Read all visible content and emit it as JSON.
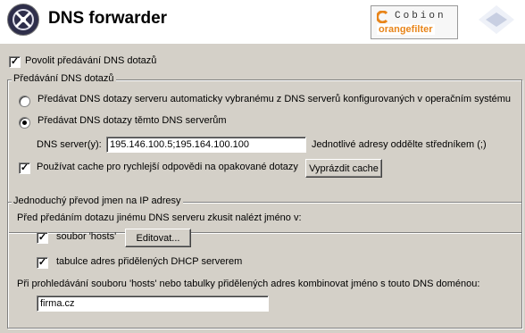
{
  "header": {
    "title": "DNS forwarder",
    "brand_top": "Cobion",
    "brand_bottom": "orangefilter"
  },
  "enable_forwarding": {
    "label": "Povolit předávání DNS dotazů",
    "checked": true
  },
  "forwarding_group": {
    "legend": "Předávání DNS dotazů",
    "radio_auto": {
      "label": "Předávat DNS dotazy serveru automaticky vybranému z DNS serverů konfigurovaných v operačním systému",
      "selected": false
    },
    "radio_manual": {
      "label": "Předávat DNS dotazy těmto DNS serverům",
      "selected": true
    },
    "dns_servers_label": "DNS server(y):",
    "dns_servers_value": "195.146.100.5;195.164.100.100",
    "dns_servers_hint": "Jednotlivé adresy oddělte středníkem (;)",
    "use_cache": {
      "label": "Používat cache pro rychlejší odpovědi na opakované dotazy",
      "checked": true
    },
    "clear_cache_button": "Vyprázdit cache"
  },
  "name_resolution_group": {
    "legend": "Jednoduchý převod jmen na IP adresy",
    "intro": "Před předáním dotazu jinému DNS serveru zkusit nalézt jméno v:",
    "hosts_file": {
      "label": "soubor 'hosts'",
      "checked": true
    },
    "edit_button": "Editovat...",
    "dhcp_table": {
      "label": "tabulce adres přidělených DHCP serverem",
      "checked": true
    },
    "domain_label": "Při prohledávání souboru 'hosts' nebo tabulky přidělených adres kombinovat jméno s touto DNS doménou:",
    "domain_value": "firma.cz"
  }
}
